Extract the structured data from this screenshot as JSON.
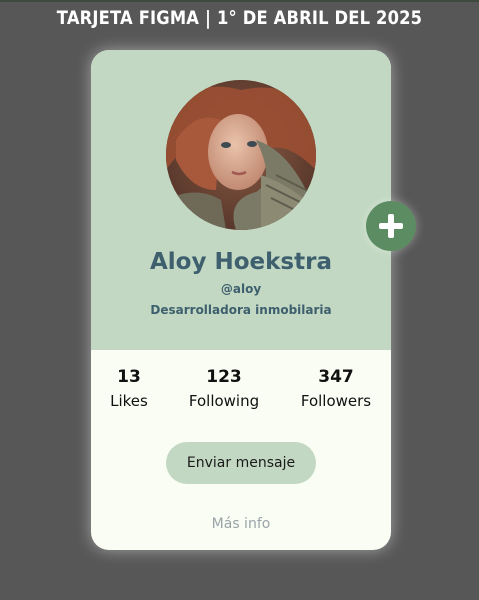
{
  "header": {
    "title": "TARJETA FIGMA | 1° DE ABRIL DEL 2025"
  },
  "profile": {
    "name": "Aloy Hoekstra",
    "handle": "@aloy",
    "role": "Desarrolladora inmobilaria",
    "avatar_icon": "profile-photo"
  },
  "stats": [
    {
      "value": "13",
      "label": "Likes"
    },
    {
      "value": "123",
      "label": "Following"
    },
    {
      "value": "347",
      "label": "Followers"
    }
  ],
  "actions": {
    "message_label": "Enviar mensaje",
    "more_label": "Más info",
    "add_icon": "plus-icon"
  },
  "colors": {
    "background": "#575757",
    "card_top": "#c2d8c2",
    "card_bottom": "#fafdf3",
    "name_text": "#3e5f6e",
    "add_button": "#5c8c62",
    "link_text": "#9aa4a8"
  }
}
